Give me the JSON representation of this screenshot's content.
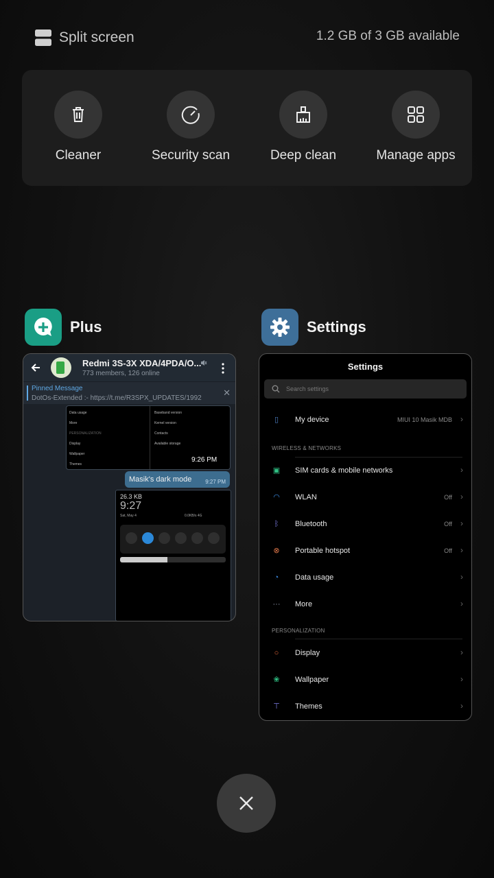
{
  "top": {
    "split_label": "Split screen",
    "memory": "1.2 GB of 3 GB available"
  },
  "tools": [
    {
      "label": "Cleaner",
      "icon": "trash-icon"
    },
    {
      "label": "Security scan",
      "icon": "gauge-icon"
    },
    {
      "label": "Deep clean",
      "icon": "broom-icon"
    },
    {
      "label": "Manage apps",
      "icon": "grid-icon"
    }
  ],
  "apps": {
    "plus": {
      "name": "Plus",
      "chat_title": "Redmi 3S-3X XDA/4PDA/O...",
      "chat_sub": "773 members, 126 online",
      "pinned_title": "Pinned Message",
      "pinned_text": "DotOs-Extended :- https://t.me/R3SPX_UPDATES/1992",
      "shot_time": "9:26 PM",
      "bubble_text": "Masik's dark mode",
      "bubble_time": "9:27 PM",
      "shot2_size": "26.3 KB",
      "shot2_clock": "9:27",
      "shot2_date": "Sat, May 4",
      "shot2_net": "0.0KB/s 4G"
    },
    "settings": {
      "name": "Settings",
      "title": "Settings",
      "search_placeholder": "Search settings",
      "rows": [
        {
          "label": "My device",
          "value": "MIUI 10 Masik MDB"
        },
        {
          "label": "SIM cards & mobile networks",
          "value": ""
        },
        {
          "label": "WLAN",
          "value": "Off"
        },
        {
          "label": "Bluetooth",
          "value": "Off"
        },
        {
          "label": "Portable hotspot",
          "value": "Off"
        },
        {
          "label": "Data usage",
          "value": ""
        },
        {
          "label": "More",
          "value": ""
        },
        {
          "label": "Display",
          "value": ""
        },
        {
          "label": "Wallpaper",
          "value": ""
        },
        {
          "label": "Themes",
          "value": ""
        }
      ],
      "sections": [
        "WIRELESS & NETWORKS",
        "PERSONALIZATION"
      ]
    }
  },
  "colors": {
    "plus_icon": "#1a9e85",
    "settings_icon": "#3e6f99",
    "accent_blue": "#2b88d8"
  }
}
